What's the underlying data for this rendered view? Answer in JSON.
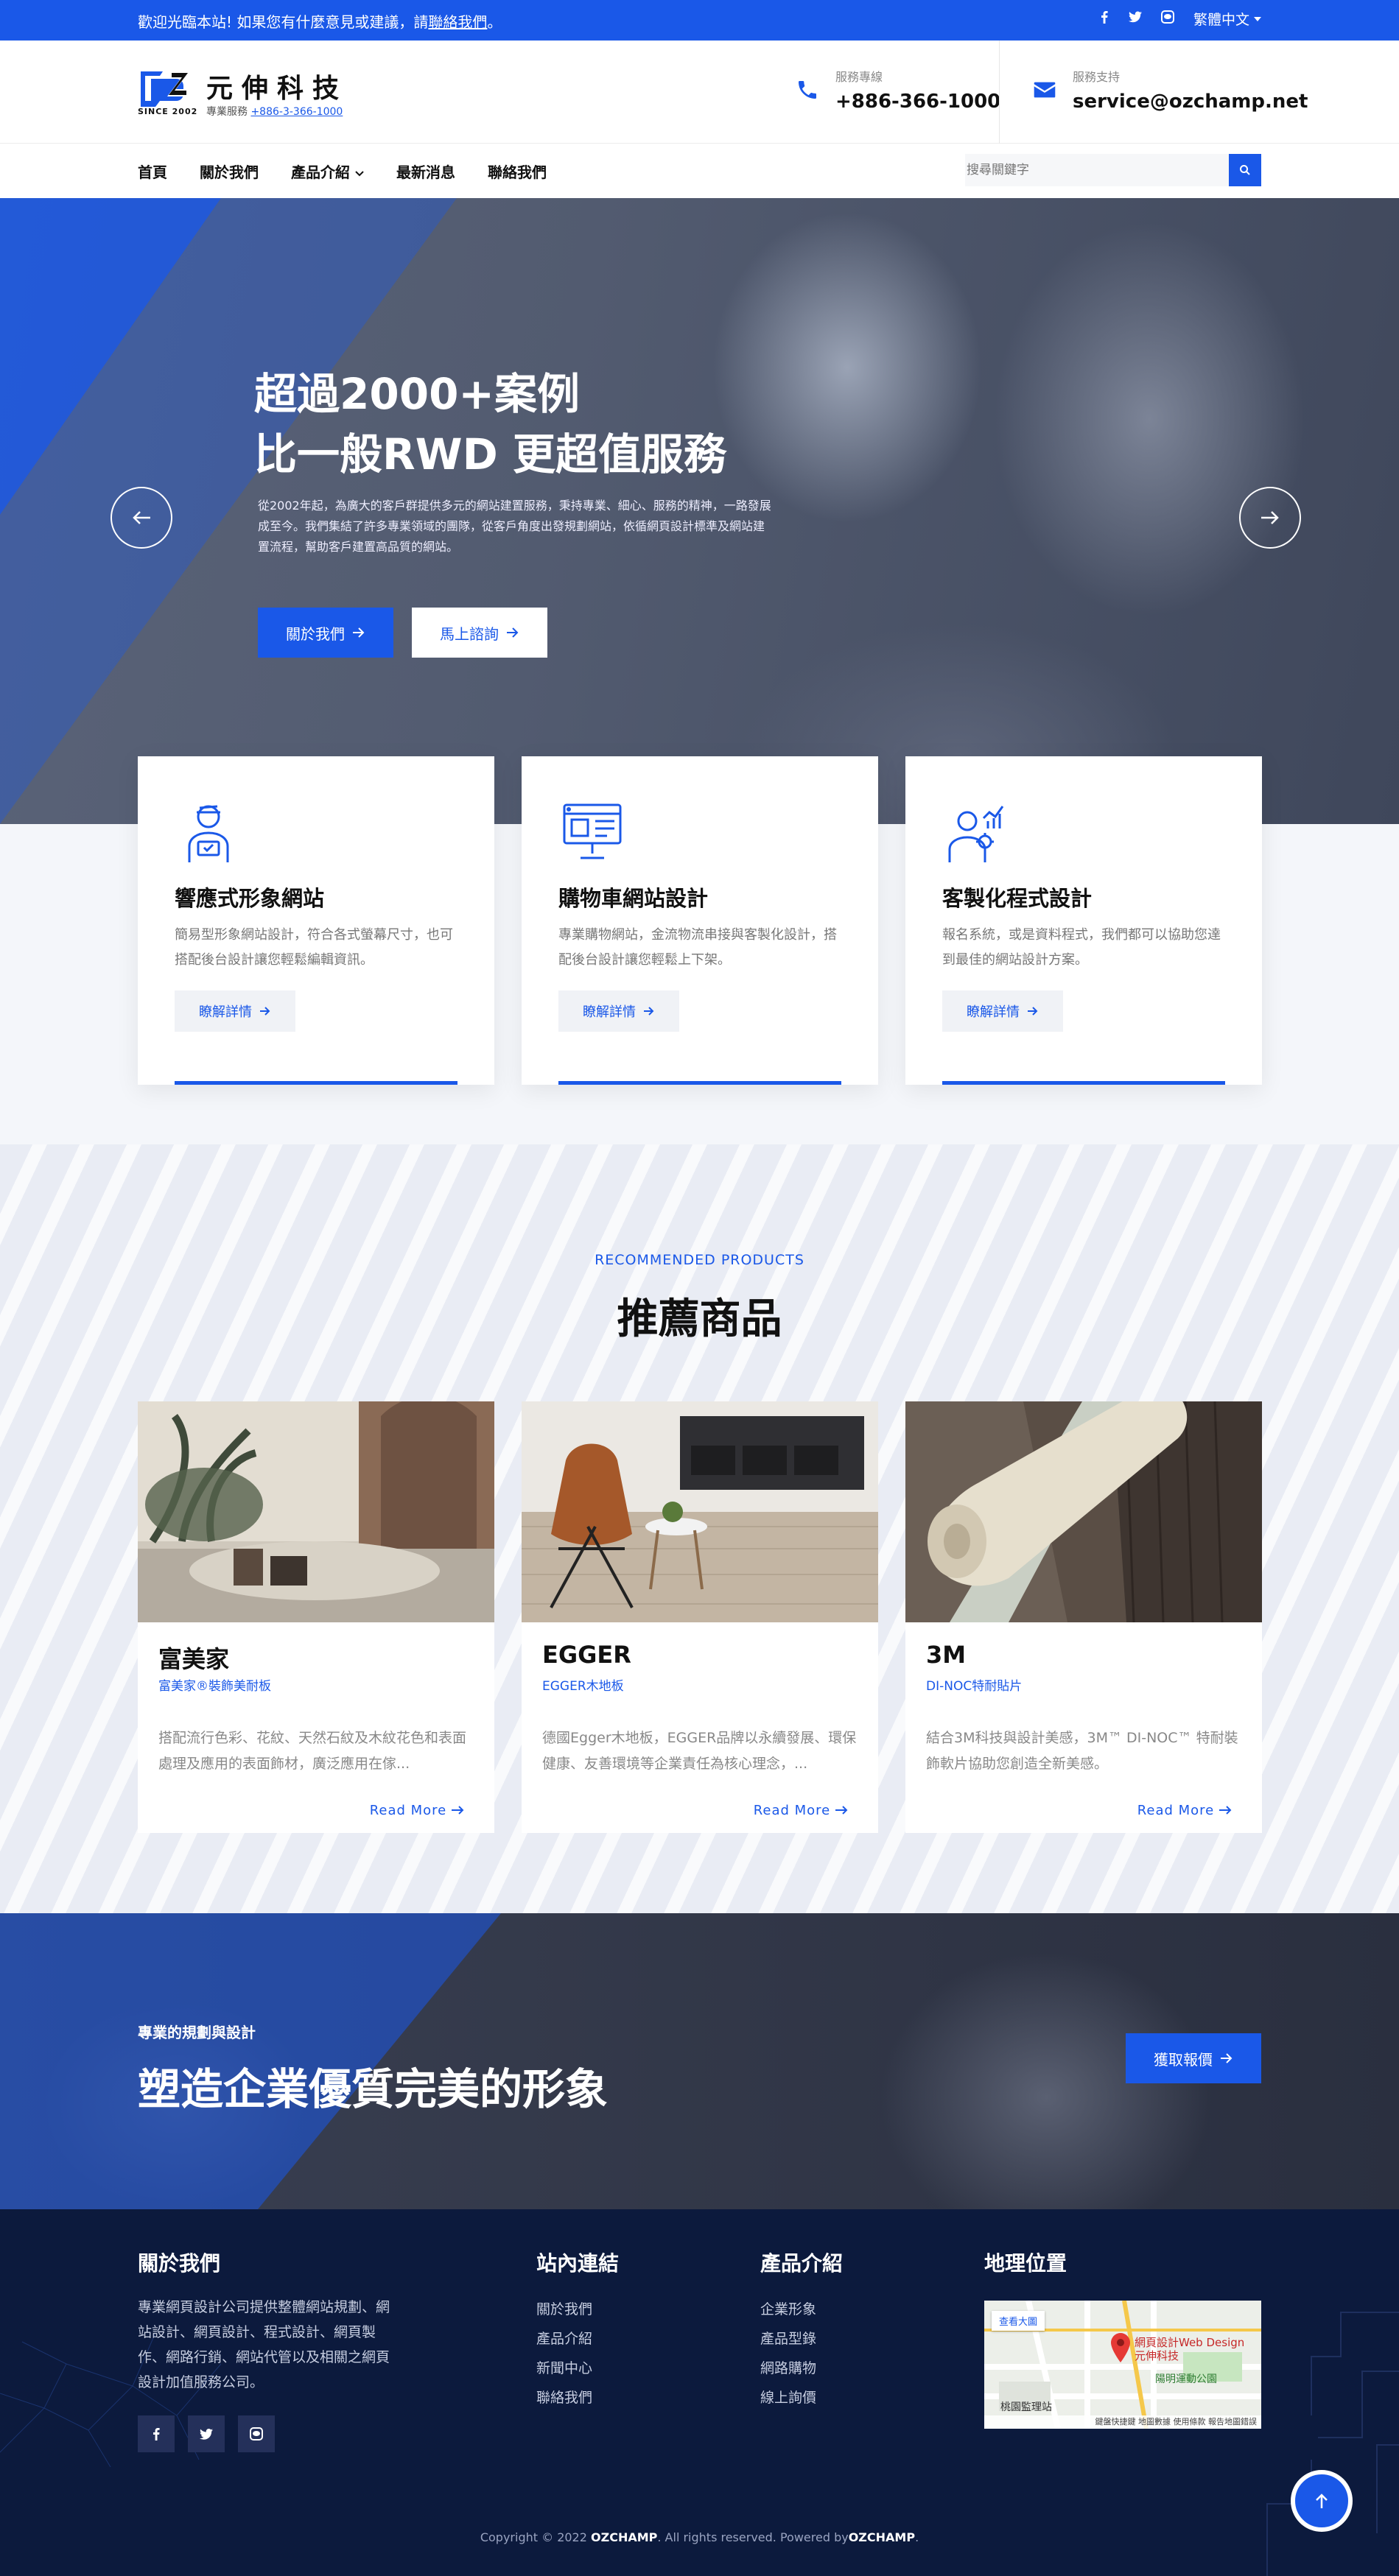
{
  "topbar": {
    "welcome_prefix": "歡迎光臨本站! 如果您有什麼意見或建議，請",
    "welcome_link": "聯絡我們",
    "welcome_suffix": "。",
    "language": "繁體中文"
  },
  "header": {
    "logo_name": "元伸科技",
    "logo_since": "SINCE 2002",
    "logo_sub_label": "專業服務",
    "logo_sub_phone": "+886-3-366-1000",
    "phone_label": "服務專線",
    "phone_value": "+886-366-1000",
    "email_label": "服務支持",
    "email_value": "service@ozchamp.net"
  },
  "nav": {
    "items": [
      "首頁",
      "關於我們",
      "產品介紹",
      "最新消息",
      "聯絡我們"
    ],
    "search_placeholder": "搜尋關鍵字"
  },
  "hero": {
    "title_line1": "超過2000+案例",
    "title_line2": "比一般RWD 更超值服務",
    "description": "從2002年起，為廣大的客戶群提供多元的網站建置服務，秉持專業、細心、服務的精神，一路發展成至今。我們集結了許多專業領域的團隊，從客戶角度出發規劃網站，依循網頁設計標準及網站建置流程，幫助客戶建置高品質的網站。",
    "btn_about": "關於我們",
    "btn_consult": "馬上諮詢"
  },
  "services": [
    {
      "title": "響應式形象網站",
      "desc": "簡易型形象網站設計，符合各式螢幕尺寸，也可搭配後台設計讓您輕鬆編輯資訊。",
      "more": "瞭解詳情",
      "icon": "designer-icon"
    },
    {
      "title": "購物車網站設計",
      "desc": "專業購物網站，金流物流串接與客製化設計，搭配後台設計讓您輕鬆上下架。",
      "more": "瞭解詳情",
      "icon": "web-design-icon"
    },
    {
      "title": "客製化程式設計",
      "desc": "報名系統，或是資料程式，我們都可以協助您達到最佳的網站設計方案。",
      "more": "瞭解詳情",
      "icon": "developer-icon"
    }
  ],
  "products": {
    "subtitle": "RECOMMENDED PRODUCTS",
    "title": "推薦商品",
    "items": [
      {
        "name": "富美家",
        "sub": "富美家®裝飾美耐板",
        "desc": "搭配流行色彩、花紋、天然石紋及木紋花色和表面處理及應用的表面飾材，廣泛應用在傢...",
        "more": "Read More"
      },
      {
        "name": "EGGER",
        "sub": "EGGER木地板",
        "desc": "德國Egger木地板，EGGER品牌以永續發展、環保健康、友善環境等企業責任為核心理念，...",
        "more": "Read More"
      },
      {
        "name": "3M",
        "sub": "DI-NOC特耐貼片",
        "desc": "結合3M科技與設計美感，3M™ DI-NOC™ 特耐裝飾軟片協助您創造全新美感。",
        "more": "Read More"
      }
    ]
  },
  "cta": {
    "subtitle": "專業的規劃與設計",
    "title": "塑造企業優質完美的形象",
    "button": "獲取報價"
  },
  "footer": {
    "about_title": "關於我們",
    "about_text": "專業網頁設計公司提供整體網站規劃、網站設計、網頁設計、程式設計、網頁製作、網路行銷、網站代管以及相關之網頁設計加值服務公司。",
    "links_title": "站內連結",
    "links": [
      "關於我們",
      "產品介紹",
      "新聞中心",
      "聯絡我們"
    ],
    "products_title": "產品介紹",
    "products": [
      "企業形象",
      "產品型錄",
      "網路購物",
      "線上詢價"
    ],
    "map_title": "地理位置",
    "map_button": "查看大圖",
    "map_pin_label": "網頁設計Web Design 元伸科技",
    "map_place1": "陽明運動公園",
    "map_place2": "桃園監理站",
    "map_attrib": "鍵盤快捷鍵  地圖數據  使用條款  報告地圖錯誤",
    "copyright_prefix": "Copyright © 2022 ",
    "copyright_brand1": "OZCHAMP",
    "copyright_mid": ". All rights reserved. Powered by",
    "copyright_brand2": "OZCHAMP",
    "copyright_suffix": "."
  },
  "colors": {
    "primary": "#1a58e8",
    "footer_bg": "#0c1a3d"
  }
}
